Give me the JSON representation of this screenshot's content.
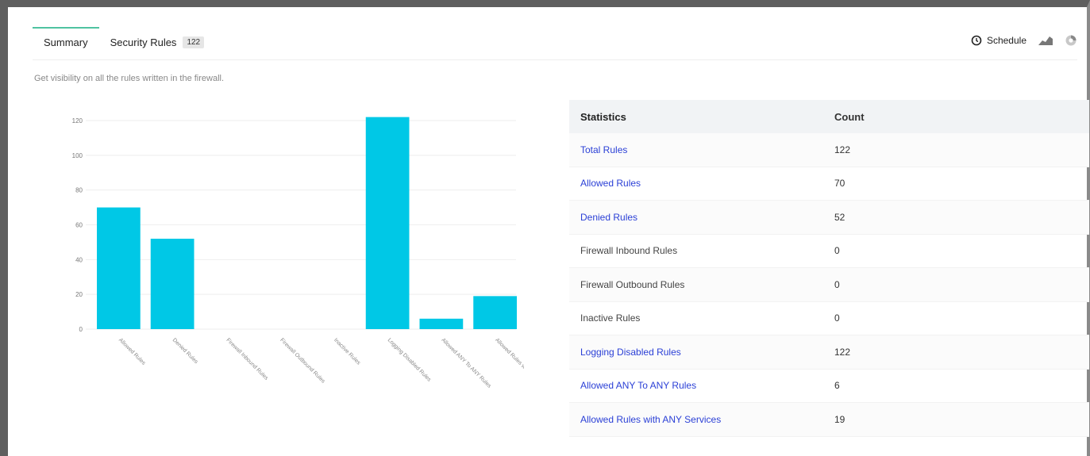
{
  "tabs": [
    {
      "label": "Summary"
    },
    {
      "label": "Security Rules",
      "badge": "122"
    }
  ],
  "toolbar": {
    "schedule_label": "Schedule",
    "icons": [
      "clock-icon",
      "chart-area-icon",
      "pie-chart-icon"
    ]
  },
  "subtitle": "Get visibility on all the rules written in the firewall.",
  "colors": {
    "accent": "#4fc3a1",
    "bar": "#00c8e6",
    "link": "#2a3fd6"
  },
  "chart_data": {
    "type": "bar",
    "categories": [
      "Allowed Rules",
      "Denied Rules",
      "Firewall Inbound Rules",
      "Firewall Outbound Rules",
      "Inactive Rules",
      "Logging Disabled Rules",
      "Allowed ANY To ANY Rules",
      "Allowed Rules with ANY Services"
    ],
    "values": [
      70,
      52,
      0,
      0,
      0,
      122,
      6,
      19
    ],
    "yticks": [
      0,
      20,
      40,
      60,
      80,
      100,
      120
    ],
    "ylim": [
      0,
      120
    ],
    "grid": true
  },
  "stats": {
    "headers": {
      "name": "Statistics",
      "count": "Count"
    },
    "rows": [
      {
        "name": "Total Rules",
        "count": "122",
        "link": true
      },
      {
        "name": "Allowed Rules",
        "count": "70",
        "link": true
      },
      {
        "name": "Denied Rules",
        "count": "52",
        "link": true
      },
      {
        "name": "Firewall Inbound Rules",
        "count": "0",
        "link": false
      },
      {
        "name": "Firewall Outbound Rules",
        "count": "0",
        "link": false
      },
      {
        "name": "Inactive Rules",
        "count": "0",
        "link": false
      },
      {
        "name": "Logging Disabled Rules",
        "count": "122",
        "link": true
      },
      {
        "name": "Allowed ANY To ANY Rules",
        "count": "6",
        "link": true
      },
      {
        "name": "Allowed Rules with ANY Services",
        "count": "19",
        "link": true
      }
    ]
  }
}
